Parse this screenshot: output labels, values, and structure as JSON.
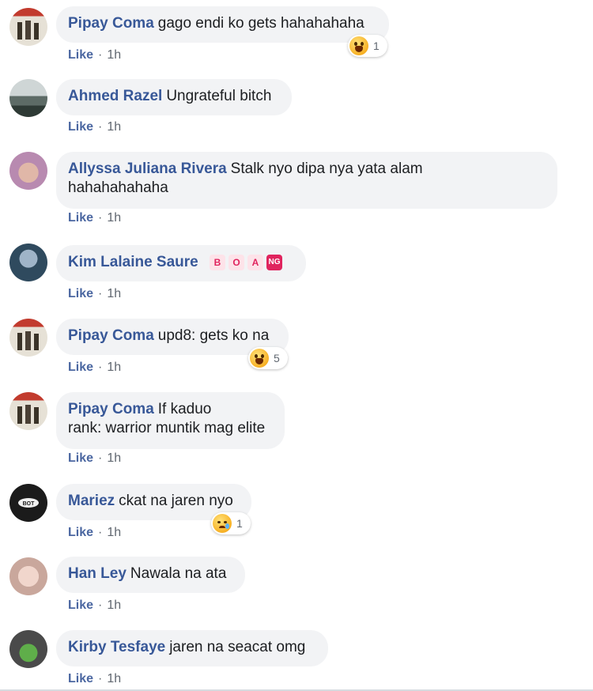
{
  "ui": {
    "like_label": "Like",
    "separator": "·",
    "accent": "#385898",
    "bubble_bg": "#f2f3f5"
  },
  "comments": [
    {
      "name": "Pipay Coma",
      "text": "gago endi ko gets hahahahaha",
      "time": "1h",
      "reaction": {
        "icon": "haha-emoji-icon",
        "count": "1"
      }
    },
    {
      "name": "Ahmed Razel",
      "text": "Ungrateful bitch",
      "time": "1h"
    },
    {
      "name": "Allyssa Juliana Rivera",
      "text": "Stalk nyo dipa nya yata alam",
      "text2": "hahahahahaha",
      "time": "1h"
    },
    {
      "name": "Kim Lalaine Saure",
      "text": "",
      "badges": [
        "B",
        "O",
        "A",
        "NG"
      ],
      "time": "1h"
    },
    {
      "name": "Pipay Coma",
      "text": "upd8: gets ko na",
      "time": "1h",
      "reaction": {
        "icon": "haha-emoji-icon",
        "count": "5"
      }
    },
    {
      "name": "Pipay Coma",
      "text": "If kaduo",
      "text2": "rank: warrior muntik mag elite",
      "time": "1h"
    },
    {
      "name": "Mariez",
      "text": "ckat na jaren nyo",
      "time": "1h",
      "reaction": {
        "icon": "sad-emoji-icon",
        "count": "1"
      }
    },
    {
      "name": "Han Ley",
      "text": "Nawala na ata",
      "time": "1h"
    },
    {
      "name": "Kirby Tesfaye",
      "text": "jaren na seacat omg",
      "time": "1h"
    }
  ]
}
